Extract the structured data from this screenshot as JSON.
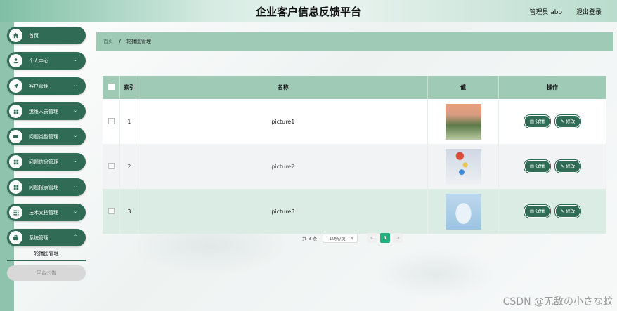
{
  "header": {
    "title": "企业客户信息反馈平台",
    "user": "管理员 abo",
    "logout": "退出登录"
  },
  "sidebar": {
    "items": [
      {
        "label": "首页",
        "icon": "home-icon",
        "has_chevron": false
      },
      {
        "label": "个人中心",
        "icon": "user-icon",
        "has_chevron": true
      },
      {
        "label": "客户管理",
        "icon": "send-icon",
        "has_chevron": true
      },
      {
        "label": "运维人员管理",
        "icon": "grid-icon",
        "has_chevron": true
      },
      {
        "label": "问题类型管理",
        "icon": "ticket-icon",
        "has_chevron": true
      },
      {
        "label": "问题信息管理",
        "icon": "grid-icon",
        "has_chevron": true
      },
      {
        "label": "问题报表管理",
        "icon": "grid-icon",
        "has_chevron": true
      },
      {
        "label": "技术文档管理",
        "icon": "apps-icon",
        "has_chevron": true
      },
      {
        "label": "系统管理",
        "icon": "briefcase-icon",
        "has_chevron": true
      }
    ],
    "sub_items": [
      {
        "label": "轮播图管理",
        "active": true
      },
      {
        "label": "平台公告",
        "active": false
      }
    ]
  },
  "breadcrumb": {
    "home": "首页",
    "separator": "/",
    "current": "轮播图管理"
  },
  "table": {
    "headers": [
      "索引",
      "名称",
      "值",
      "操作"
    ],
    "rows": [
      {
        "index": "1",
        "name": "picture1",
        "thumb_colors": [
          "#e8a07c",
          "#5c7a4a",
          "#b8c8a0"
        ]
      },
      {
        "index": "2",
        "name": "picture2",
        "thumb_colors": [
          "#cfd8e4",
          "#d94a3a",
          "#e6c64a"
        ]
      },
      {
        "index": "3",
        "name": "picture3",
        "thumb_colors": [
          "#bcd8ee",
          "#e8f2f8",
          "#9cc4e0"
        ]
      }
    ],
    "detail_label": "详情",
    "edit_label": "修改"
  },
  "pagination": {
    "total": "共 3 条",
    "page_size": "10条/页",
    "prev": "<",
    "current_page": "1",
    "next": ">"
  },
  "watermark": "CSDN @无敌の小さな蚊",
  "colors": {
    "accent": "#2f6b55",
    "header_bg": "#9fcab6",
    "active_page": "#22b07d"
  }
}
